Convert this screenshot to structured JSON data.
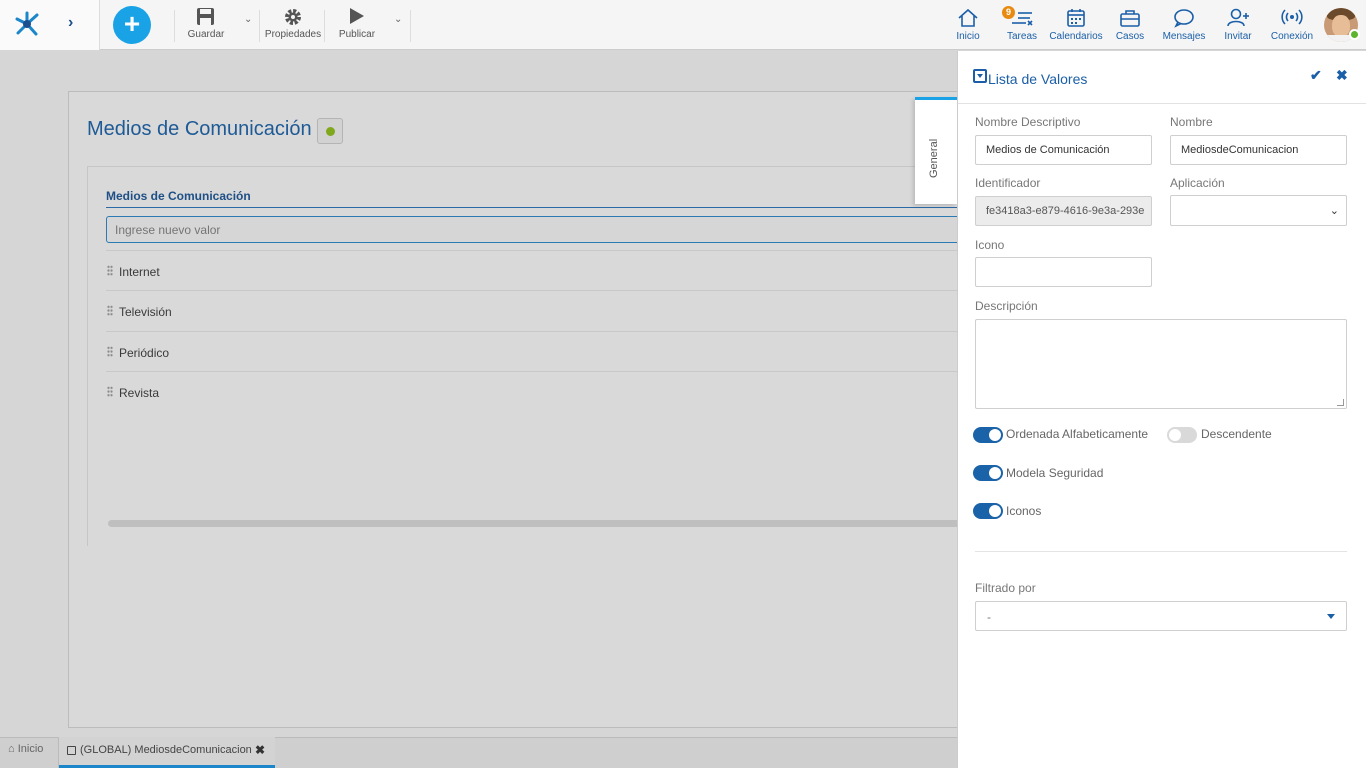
{
  "toolbar": {
    "save_label": "Guardar",
    "properties_label": "Propiedades",
    "publish_label": "Publicar"
  },
  "nav": {
    "home": "Inicio",
    "tasks": "Tareas",
    "tasks_badge": "9",
    "calendars": "Calendarios",
    "cases": "Casos",
    "messages": "Mensajes",
    "invite": "Invitar",
    "connection": "Conexión"
  },
  "form": {
    "title": "Medios de Comunicación",
    "list_title": "Medios de Comunicación",
    "new_value_placeholder": "Ingrese nuevo valor",
    "values": [
      "Internet",
      "Televisión",
      "Periódico",
      "Revista"
    ]
  },
  "side_tab": {
    "label": "General"
  },
  "panel": {
    "title": "Lista de Valores",
    "fields": {
      "descriptive_name_label": "Nombre Descriptivo",
      "descriptive_name_value": "Medios de Comunicación",
      "name_label": "Nombre",
      "name_value": "MediosdeComunicacion",
      "identifier_label": "Identificador",
      "identifier_value": "fe3418a3-e879-4616-9e3a-293e",
      "application_label": "Aplicación",
      "application_value": "",
      "icon_label": "Icono",
      "icon_value": "",
      "description_label": "Descripción"
    },
    "toggles": {
      "sorted_label": "Ordenada Alfabeticamente",
      "sorted_on": true,
      "descending_label": "Descendente",
      "descending_on": false,
      "security_label": "Modela Seguridad",
      "security_on": true,
      "icons_label": "Iconos",
      "icons_on": true
    },
    "filter_label": "Filtrado por",
    "filter_value": "-"
  },
  "bottom_tabs": {
    "home": "Inicio",
    "doc": "(GLOBAL) MediosdeComunicacion"
  },
  "colors": {
    "accent": "#1b5fa8",
    "add_button": "#19a3e6",
    "badge": "#e88a10",
    "online": "#5db52f"
  }
}
